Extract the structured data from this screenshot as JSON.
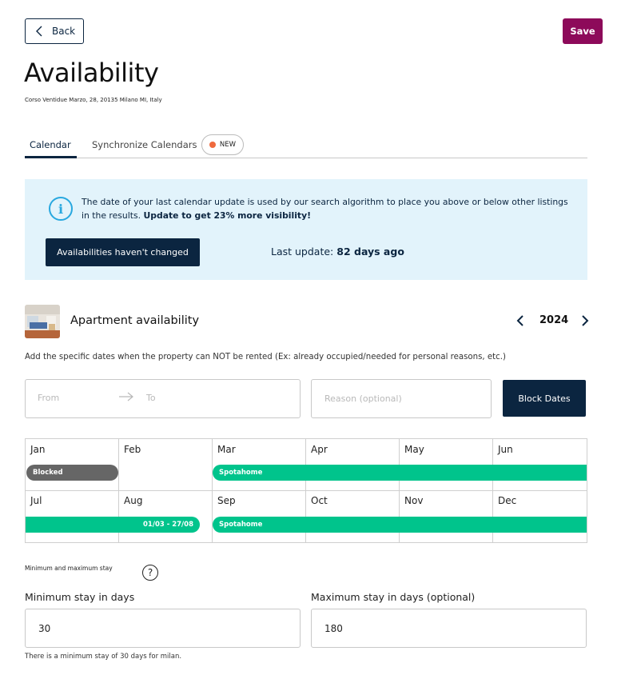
{
  "header": {
    "back_label": "Back",
    "save_label": "Save",
    "title": "Availability",
    "address": "Corso Ventidue Marzo, 28, 20135 Milano MI, Italy"
  },
  "tabs": [
    {
      "label": "Calendar",
      "active": true
    },
    {
      "label": "Synchronize Calendars",
      "active": false,
      "badge": "NEW"
    }
  ],
  "banner": {
    "text": "The date of your last calendar update is used by our search algorithm to place you above or below other listings in the results.",
    "text_bold": "Update to get 23% more visibility!",
    "button_label": "Availabilities haven't changed",
    "last_update_label": "Last update:",
    "last_update_value": "82 days ago"
  },
  "apartment": {
    "title": "Apartment availability",
    "year": "2024",
    "hint": "Add the specific dates when the property can NOT be rented (Ex: already occupied/needed for personal reasons, etc.)",
    "from_placeholder": "From",
    "to_placeholder": "To",
    "reason_placeholder": "Reason (optional)",
    "block_button": "Block Dates"
  },
  "calendar": {
    "months": [
      "Jan",
      "Feb",
      "Mar",
      "Apr",
      "May",
      "Jun",
      "Jul",
      "Aug",
      "Sep",
      "Oct",
      "Nov",
      "Dec"
    ],
    "bars": {
      "blocked_label": "Blocked",
      "spotahome_row1": "Spotahome",
      "range_label": "01/03 - 27/08",
      "spotahome_row2": "Spotahome"
    }
  },
  "stays": {
    "heading": "Minimum and maximum stay",
    "help_icon": "?",
    "min_label": "Minimum stay in days",
    "min_value": "30",
    "max_label": "Maximum stay in days (optional)",
    "max_value": "180",
    "note": "There is a minimum stay of 30 days for milan."
  },
  "colors": {
    "primary_navy": "#0b2540",
    "save_magenta": "#8d0a5a",
    "banner_bg": "#e2f3fb",
    "info_blue": "#29a8df",
    "booking_green": "#00c48c",
    "blocked_grey": "#666666",
    "new_dot": "#ef6a3e"
  }
}
